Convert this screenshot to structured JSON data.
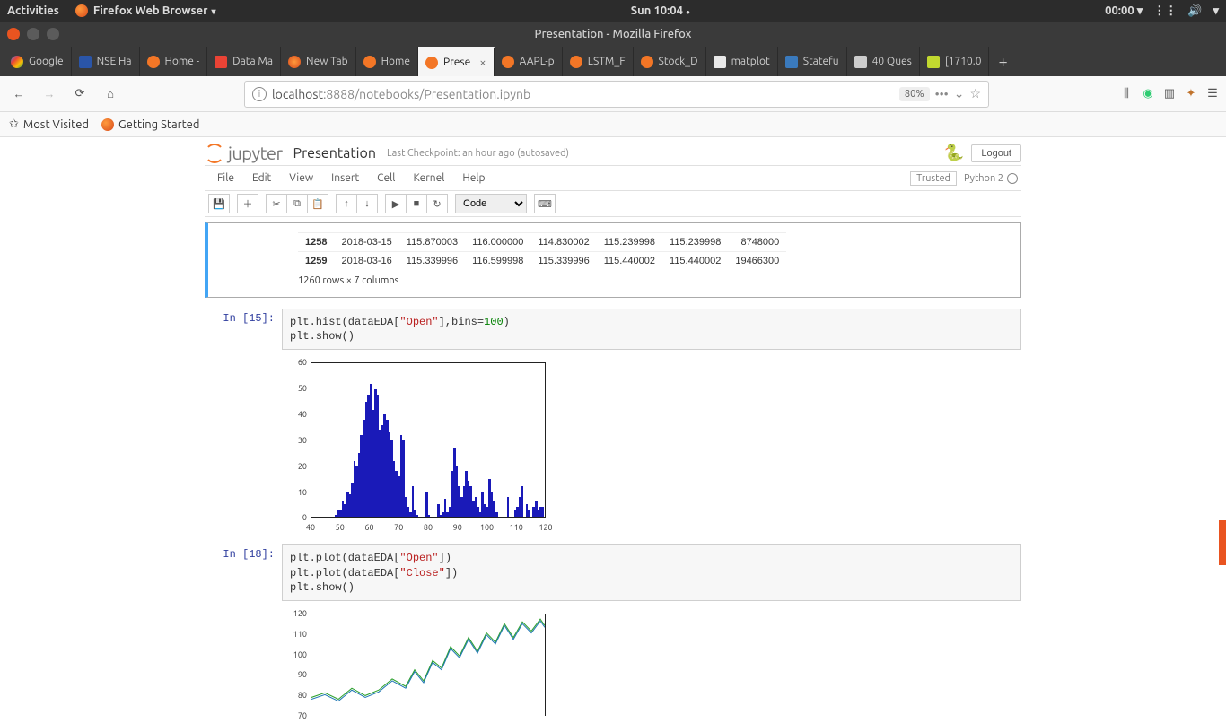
{
  "ubuntu": {
    "activities": "Activities",
    "app": "Firefox Web Browser",
    "clock": "Sun 10:04",
    "timer": "00:00"
  },
  "window_title": "Presentation - Mozilla Firefox",
  "tabs": [
    {
      "label": "Google",
      "iconCls": "google"
    },
    {
      "label": "NSE Ha",
      "iconCls": "nse"
    },
    {
      "label": "Home -",
      "iconCls": "jup"
    },
    {
      "label": "Data Ma",
      "iconCls": "gmail"
    },
    {
      "label": "New Tab",
      "iconCls": "ff"
    },
    {
      "label": "Home",
      "iconCls": "jup"
    },
    {
      "label": "Prese",
      "iconCls": "jup",
      "active": true,
      "closable": true
    },
    {
      "label": "AAPL-p",
      "iconCls": "jup"
    },
    {
      "label": "LSTM_F",
      "iconCls": "jup"
    },
    {
      "label": "Stock_D",
      "iconCls": "jup"
    },
    {
      "label": "matplot",
      "iconCls": "mpl"
    },
    {
      "label": "Statefu",
      "iconCls": "ai"
    },
    {
      "label": "40 Ques",
      "iconCls": "av"
    },
    {
      "label": "[1710.0",
      "iconCls": "arxiv"
    }
  ],
  "url": {
    "info": "i",
    "host": "localhost",
    "port": ":8888",
    "path": "/notebooks/Presentation.ipynb",
    "zoom": "80%"
  },
  "bookmarks": {
    "mostVisited": "Most Visited",
    "gettingStarted": "Getting Started"
  },
  "jup": {
    "brand": "jupyter",
    "title": "Presentation",
    "autosave": "Last Checkpoint: an hour ago (autosaved)",
    "logout": "Logout",
    "trusted": "Trusted",
    "kernel": "Python 2",
    "menus": [
      "File",
      "Edit",
      "View",
      "Insert",
      "Cell",
      "Kernel",
      "Help"
    ],
    "cellType": "Code"
  },
  "df": {
    "rows": [
      {
        "idx": "1258",
        "date": "2018-03-15",
        "open": "115.870003",
        "high": "116.000000",
        "low": "114.830002",
        "close": "115.239998",
        "adj": "115.239998",
        "vol": "8748000"
      },
      {
        "idx": "1259",
        "date": "2018-03-16",
        "open": "115.339996",
        "high": "116.599998",
        "low": "115.339996",
        "close": "115.440002",
        "adj": "115.440002",
        "vol": "19466300"
      }
    ],
    "summary": "1260 rows × 7 columns"
  },
  "cells": {
    "c15": {
      "prompt": "In [15]:",
      "line1a": "plt.hist(dataEDA[",
      "line1b": "\"Open\"",
      "line1c": "],bins=",
      "line1d": "100",
      "line1e": ")",
      "line2": "plt.show()"
    },
    "c18": {
      "prompt": "In [18]:",
      "l1a": "plt.plot(dataEDA[",
      "l1b": "\"Open\"",
      "l1c": "])",
      "l2a": "plt.plot(dataEDA[",
      "l2b": "\"Close\"",
      "l2c": "])",
      "l3": "plt.show()"
    }
  },
  "chart_data": [
    {
      "type": "bar",
      "title": "",
      "xlabel": "",
      "ylabel": "",
      "xlim": [
        40,
        120
      ],
      "ylim": [
        0,
        60
      ],
      "xticks": [
        40,
        50,
        60,
        70,
        80,
        90,
        100,
        110,
        120
      ],
      "yticks": [
        0,
        10,
        20,
        30,
        40,
        50,
        60
      ],
      "bin_edges_start": 40,
      "bin_width": 0.8,
      "nbins": 100,
      "values": [
        0,
        0,
        0,
        0,
        0,
        0,
        0,
        0,
        0,
        0,
        1,
        3,
        3,
        6,
        5,
        10,
        9,
        13,
        22,
        20,
        25,
        32,
        38,
        45,
        48,
        52,
        42,
        50,
        48,
        34,
        36,
        40,
        38,
        33,
        30,
        22,
        18,
        16,
        32,
        30,
        8,
        4,
        2,
        12,
        3,
        1,
        0,
        0,
        0,
        10,
        1,
        0,
        0,
        0,
        5,
        1,
        2,
        7,
        2,
        4,
        18,
        27,
        20,
        12,
        8,
        12,
        18,
        14,
        12,
        6,
        8,
        4,
        2,
        10,
        5,
        4,
        15,
        10,
        6,
        2,
        0,
        0,
        0,
        0,
        8,
        0,
        0,
        3,
        4,
        8,
        12,
        0,
        5,
        3,
        0,
        4,
        6,
        3,
        4,
        4
      ]
    },
    {
      "type": "line",
      "title": "",
      "xlabel": "",
      "ylabel": "",
      "ylim": [
        70,
        120
      ],
      "visible_yticks": [
        70,
        80,
        90,
        100,
        110,
        120
      ],
      "series": [
        {
          "name": "Open",
          "color": "#1f77b4"
        },
        {
          "name": "Close",
          "color": "#2ca02c"
        }
      ],
      "note": "partially visible; x-axis cut off at bottom of viewport"
    }
  ]
}
